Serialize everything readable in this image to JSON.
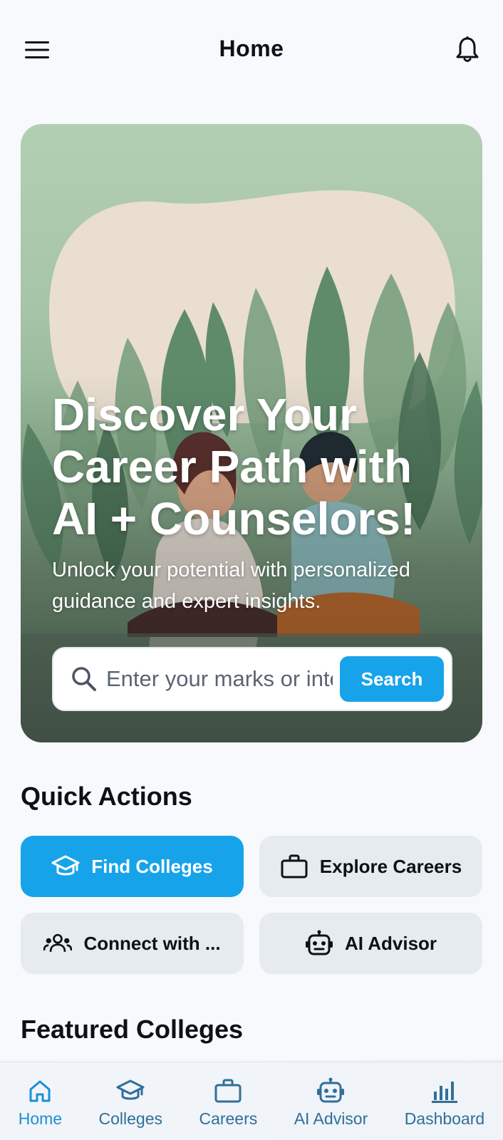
{
  "header": {
    "title": "Home",
    "menu_icon": "hamburger-menu-icon",
    "notification_icon": "bell-icon"
  },
  "hero": {
    "heading": "Discover Your Career Path with AI + Counselors!",
    "subheading": "Unlock your potential with personalized guidance and expert insights.",
    "search": {
      "placeholder": "Enter your marks or interests",
      "button_label": "Search",
      "icon": "search-icon"
    }
  },
  "quick_actions": {
    "title": "Quick Actions",
    "items": [
      {
        "label": "Find Colleges",
        "icon": "graduation-cap-icon",
        "primary": true
      },
      {
        "label": "Explore Careers",
        "icon": "briefcase-icon",
        "primary": false
      },
      {
        "label": "Connect with ...",
        "icon": "people-group-icon",
        "primary": false
      },
      {
        "label": "AI Advisor",
        "icon": "robot-icon",
        "primary": false
      }
    ]
  },
  "featured": {
    "title": "Featured Colleges"
  },
  "bottom_nav": {
    "items": [
      {
        "label": "Home",
        "icon": "home-icon",
        "active": true
      },
      {
        "label": "Colleges",
        "icon": "graduation-cap-icon",
        "active": false
      },
      {
        "label": "Careers",
        "icon": "briefcase-icon",
        "active": false
      },
      {
        "label": "AI Advisor",
        "icon": "robot-icon",
        "active": false
      },
      {
        "label": "Dashboard",
        "icon": "bar-chart-icon",
        "active": false
      }
    ]
  },
  "colors": {
    "accent": "#17a3ea",
    "nav_active": "#1c8fd6",
    "nav_inactive": "#2f6f9a",
    "background": "#f7f9fc"
  }
}
